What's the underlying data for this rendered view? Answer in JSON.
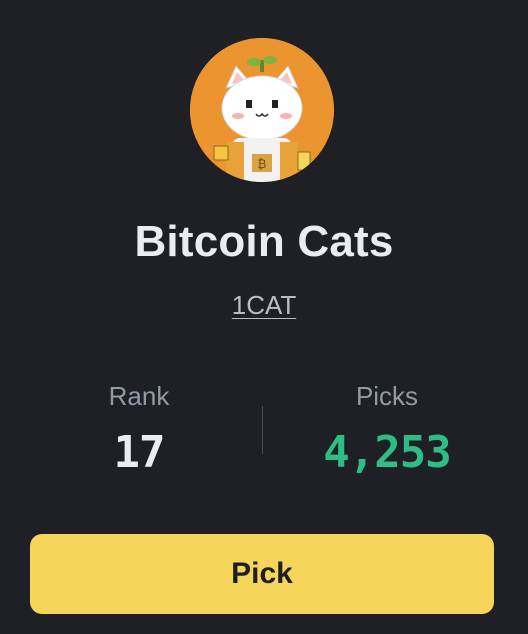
{
  "token": {
    "avatar_icon": "pixel-cat-avatar-icon",
    "name": "Bitcoin Cats",
    "ticker": "1CAT"
  },
  "stats": {
    "rank_label": "Rank",
    "rank_value": "17",
    "picks_label": "Picks",
    "picks_value": "4,253"
  },
  "actions": {
    "pick_label": "Pick"
  },
  "colors": {
    "background": "#1e2026",
    "avatar_bg": "#ec9430",
    "accent_yellow": "#f5d55a",
    "positive_green": "#2ebd85",
    "text_primary": "#eaecef",
    "text_secondary": "#929aa5"
  }
}
